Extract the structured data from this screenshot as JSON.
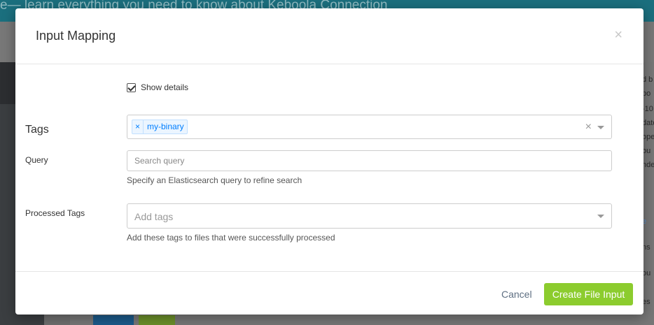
{
  "background": {
    "banner_text": "e— learn everything you need to know about Keboola Connection",
    "right_fragments": [
      "d b",
      "po",
      "-10",
      "date",
      "ope",
      "ou",
      "nde",
      "e",
      "ns",
      "ou",
      "es"
    ]
  },
  "modal": {
    "title": "Input Mapping",
    "close_icon": "×",
    "show_details_label": "Show details",
    "show_details_checked": true,
    "tags": {
      "label": "Tags",
      "chips": [
        {
          "remove": "×",
          "label": "my-binary"
        }
      ],
      "clear_icon": "×"
    },
    "query": {
      "label": "Query",
      "placeholder": "Search query",
      "value": "",
      "help": "Specify an Elasticsearch query to refine search"
    },
    "processed_tags": {
      "label": "Processed Tags",
      "placeholder": "Add tags",
      "help": "Add these tags to files that were successfully processed"
    },
    "footer": {
      "cancel_label": "Cancel",
      "create_label": "Create File Input"
    }
  },
  "colors": {
    "accent_green": "#8ccc2e",
    "chip_blue": "#007eff"
  }
}
